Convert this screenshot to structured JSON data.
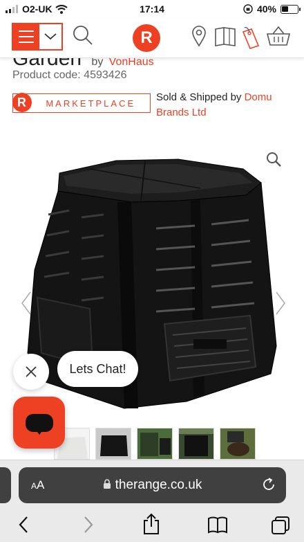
{
  "status": {
    "carrier": "O2-UK",
    "time": "17:14",
    "battery": "40%"
  },
  "header": {
    "logo_letter": "R"
  },
  "product": {
    "title_partial": "Garden",
    "by_label": "by",
    "brand": "VonHaus",
    "code_label": "Product code: 4593426"
  },
  "marketplace": {
    "badge_letter": "R",
    "badge_text": "MARKETPLACE",
    "sold_label": "Sold & Shipped by",
    "seller": "Domu Brands Ltd"
  },
  "chat": {
    "bubble_text": "Lets Chat!"
  },
  "browser": {
    "aa_label_small": "A",
    "aa_label_big": "A",
    "url": "therange.co.uk"
  },
  "colors": {
    "brand": "#ee4023",
    "urlbar": "#404040"
  }
}
